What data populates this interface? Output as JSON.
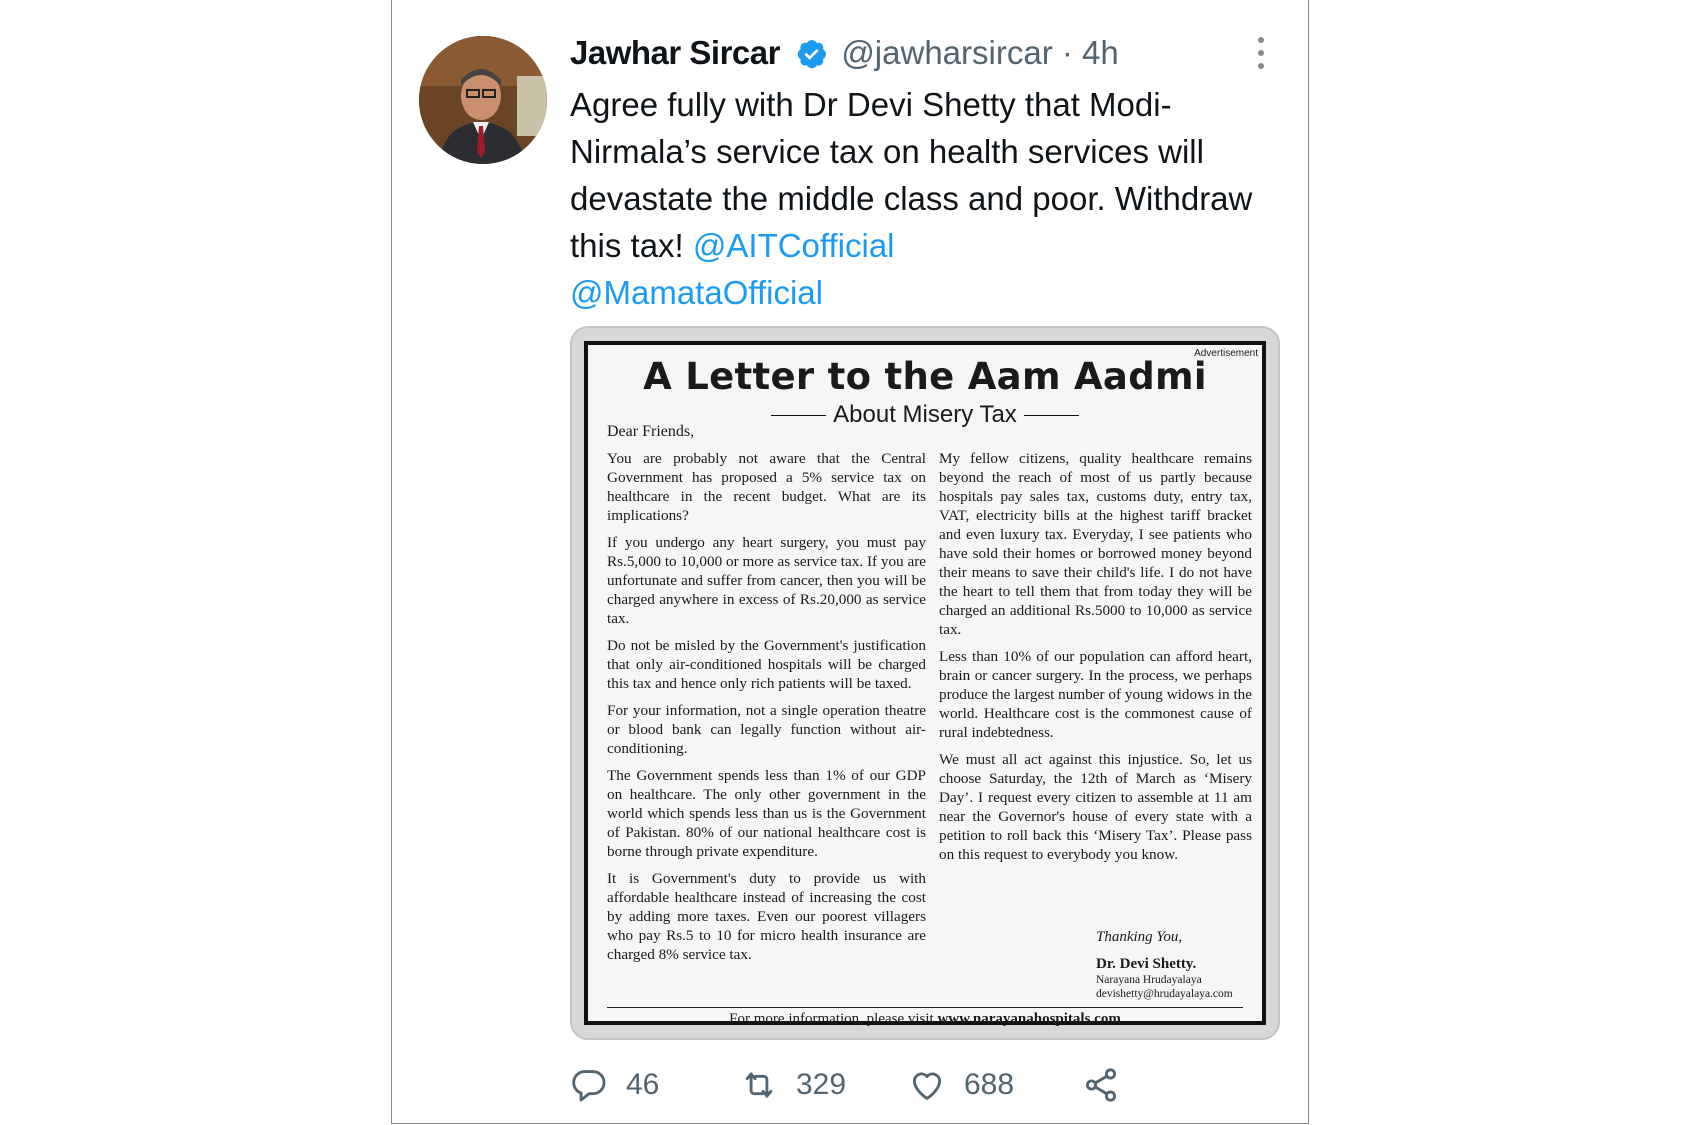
{
  "tweet": {
    "author_name": "Jawhar Sircar",
    "handle": "@jawharsircar",
    "separator": "·",
    "time": "4h",
    "text": "Agree fully with Dr Devi Shetty that Modi-Nirmala’s service tax on health services will devastate the middle class and poor. Withdraw this tax!",
    "mentions": [
      "@AITCofficial",
      "@MamataOfficial"
    ],
    "accent_color": "#1d9bf0"
  },
  "ad": {
    "label": "Advertisement",
    "title": "A Letter to the Aam Aadmi",
    "subtitle": "About Misery Tax",
    "greeting": "Dear Friends,",
    "left_paragraphs": [
      "You are probably not aware that the Central Government has proposed a 5% service tax on healthcare in the recent budget. What are its implications?",
      "If you undergo any heart surgery, you must pay Rs.5,000 to 10,000 or more as service tax. If you are unfortunate and suffer from cancer, then you will be charged anywhere in excess of Rs.20,000 as service tax.",
      "Do not be misled by the Government's justification that only air-conditioned hospitals will be charged this tax and hence only rich patients will be taxed.",
      "For your information, not a single operation theatre or blood bank can legally function without air-conditioning.",
      "The Government spends less than 1% of our GDP on healthcare. The only other government in the world which spends less than us is the Government of Pakistan. 80% of our national healthcare cost is borne through private expenditure.",
      "It is Government's duty to provide us with affordable healthcare instead of increasing the cost by adding more taxes. Even our poorest villagers who pay Rs.5 to 10 for micro health insurance are charged 8% service tax."
    ],
    "right_paragraphs": [
      "My fellow citizens, quality healthcare remains beyond the reach of most of us partly because hospitals pay sales tax, customs duty, entry tax, VAT, electricity bills at the highest tariff bracket and even luxury tax. Everyday, I see patients who have sold their homes or borrowed money beyond their means to save their child's life. I do not have the heart to tell them that from today they will be charged an additional Rs.5000 to 10,000 as service tax.",
      "Less than 10% of our population can afford heart, brain or cancer surgery. In the process, we perhaps produce the largest number of young widows in the world. Healthcare cost is the commonest cause of rural indebtedness.",
      "We must all act against this injustice. So, let us choose Saturday, the 12th of March as ‘Misery Day’. I request every citizen to assemble at 11 am near the Governor's house of every state with a petition to roll back this ‘Misery Tax’. Please pass on this request to everybody you know."
    ],
    "thanks": "Thanking You,",
    "signer": "Dr. Devi Shetty.",
    "org": "Narayana Hrudayalaya",
    "email": "devishetty@hrudayalaya.com",
    "footer_prefix": "For more information, please visit",
    "footer_url": "www.narayanahospitals.com"
  },
  "actions": {
    "reply_icon": "reply-icon",
    "replies": "46",
    "retweet_icon": "retweet-icon",
    "retweets": "329",
    "like_icon": "heart-icon",
    "likes": "688",
    "share_icon": "share-icon"
  }
}
